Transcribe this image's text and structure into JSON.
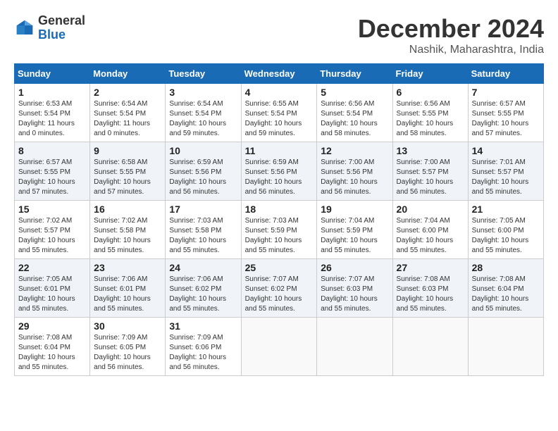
{
  "logo": {
    "general": "General",
    "blue": "Blue"
  },
  "title": "December 2024",
  "location": "Nashik, Maharashtra, India",
  "days_of_week": [
    "Sunday",
    "Monday",
    "Tuesday",
    "Wednesday",
    "Thursday",
    "Friday",
    "Saturday"
  ],
  "weeks": [
    [
      {
        "day": "1",
        "sunrise": "6:53 AM",
        "sunset": "5:54 PM",
        "daylight": "11 hours and 0 minutes."
      },
      {
        "day": "2",
        "sunrise": "6:54 AM",
        "sunset": "5:54 PM",
        "daylight": "11 hours and 0 minutes."
      },
      {
        "day": "3",
        "sunrise": "6:54 AM",
        "sunset": "5:54 PM",
        "daylight": "10 hours and 59 minutes."
      },
      {
        "day": "4",
        "sunrise": "6:55 AM",
        "sunset": "5:54 PM",
        "daylight": "10 hours and 59 minutes."
      },
      {
        "day": "5",
        "sunrise": "6:56 AM",
        "sunset": "5:54 PM",
        "daylight": "10 hours and 58 minutes."
      },
      {
        "day": "6",
        "sunrise": "6:56 AM",
        "sunset": "5:55 PM",
        "daylight": "10 hours and 58 minutes."
      },
      {
        "day": "7",
        "sunrise": "6:57 AM",
        "sunset": "5:55 PM",
        "daylight": "10 hours and 57 minutes."
      }
    ],
    [
      {
        "day": "8",
        "sunrise": "6:57 AM",
        "sunset": "5:55 PM",
        "daylight": "10 hours and 57 minutes."
      },
      {
        "day": "9",
        "sunrise": "6:58 AM",
        "sunset": "5:55 PM",
        "daylight": "10 hours and 57 minutes."
      },
      {
        "day": "10",
        "sunrise": "6:59 AM",
        "sunset": "5:56 PM",
        "daylight": "10 hours and 56 minutes."
      },
      {
        "day": "11",
        "sunrise": "6:59 AM",
        "sunset": "5:56 PM",
        "daylight": "10 hours and 56 minutes."
      },
      {
        "day": "12",
        "sunrise": "7:00 AM",
        "sunset": "5:56 PM",
        "daylight": "10 hours and 56 minutes."
      },
      {
        "day": "13",
        "sunrise": "7:00 AM",
        "sunset": "5:57 PM",
        "daylight": "10 hours and 56 minutes."
      },
      {
        "day": "14",
        "sunrise": "7:01 AM",
        "sunset": "5:57 PM",
        "daylight": "10 hours and 55 minutes."
      }
    ],
    [
      {
        "day": "15",
        "sunrise": "7:02 AM",
        "sunset": "5:57 PM",
        "daylight": "10 hours and 55 minutes."
      },
      {
        "day": "16",
        "sunrise": "7:02 AM",
        "sunset": "5:58 PM",
        "daylight": "10 hours and 55 minutes."
      },
      {
        "day": "17",
        "sunrise": "7:03 AM",
        "sunset": "5:58 PM",
        "daylight": "10 hours and 55 minutes."
      },
      {
        "day": "18",
        "sunrise": "7:03 AM",
        "sunset": "5:59 PM",
        "daylight": "10 hours and 55 minutes."
      },
      {
        "day": "19",
        "sunrise": "7:04 AM",
        "sunset": "5:59 PM",
        "daylight": "10 hours and 55 minutes."
      },
      {
        "day": "20",
        "sunrise": "7:04 AM",
        "sunset": "6:00 PM",
        "daylight": "10 hours and 55 minutes."
      },
      {
        "day": "21",
        "sunrise": "7:05 AM",
        "sunset": "6:00 PM",
        "daylight": "10 hours and 55 minutes."
      }
    ],
    [
      {
        "day": "22",
        "sunrise": "7:05 AM",
        "sunset": "6:01 PM",
        "daylight": "10 hours and 55 minutes."
      },
      {
        "day": "23",
        "sunrise": "7:06 AM",
        "sunset": "6:01 PM",
        "daylight": "10 hours and 55 minutes."
      },
      {
        "day": "24",
        "sunrise": "7:06 AM",
        "sunset": "6:02 PM",
        "daylight": "10 hours and 55 minutes."
      },
      {
        "day": "25",
        "sunrise": "7:07 AM",
        "sunset": "6:02 PM",
        "daylight": "10 hours and 55 minutes."
      },
      {
        "day": "26",
        "sunrise": "7:07 AM",
        "sunset": "6:03 PM",
        "daylight": "10 hours and 55 minutes."
      },
      {
        "day": "27",
        "sunrise": "7:08 AM",
        "sunset": "6:03 PM",
        "daylight": "10 hours and 55 minutes."
      },
      {
        "day": "28",
        "sunrise": "7:08 AM",
        "sunset": "6:04 PM",
        "daylight": "10 hours and 55 minutes."
      }
    ],
    [
      {
        "day": "29",
        "sunrise": "7:08 AM",
        "sunset": "6:04 PM",
        "daylight": "10 hours and 55 minutes."
      },
      {
        "day": "30",
        "sunrise": "7:09 AM",
        "sunset": "6:05 PM",
        "daylight": "10 hours and 56 minutes."
      },
      {
        "day": "31",
        "sunrise": "7:09 AM",
        "sunset": "6:06 PM",
        "daylight": "10 hours and 56 minutes."
      },
      null,
      null,
      null,
      null
    ]
  ]
}
